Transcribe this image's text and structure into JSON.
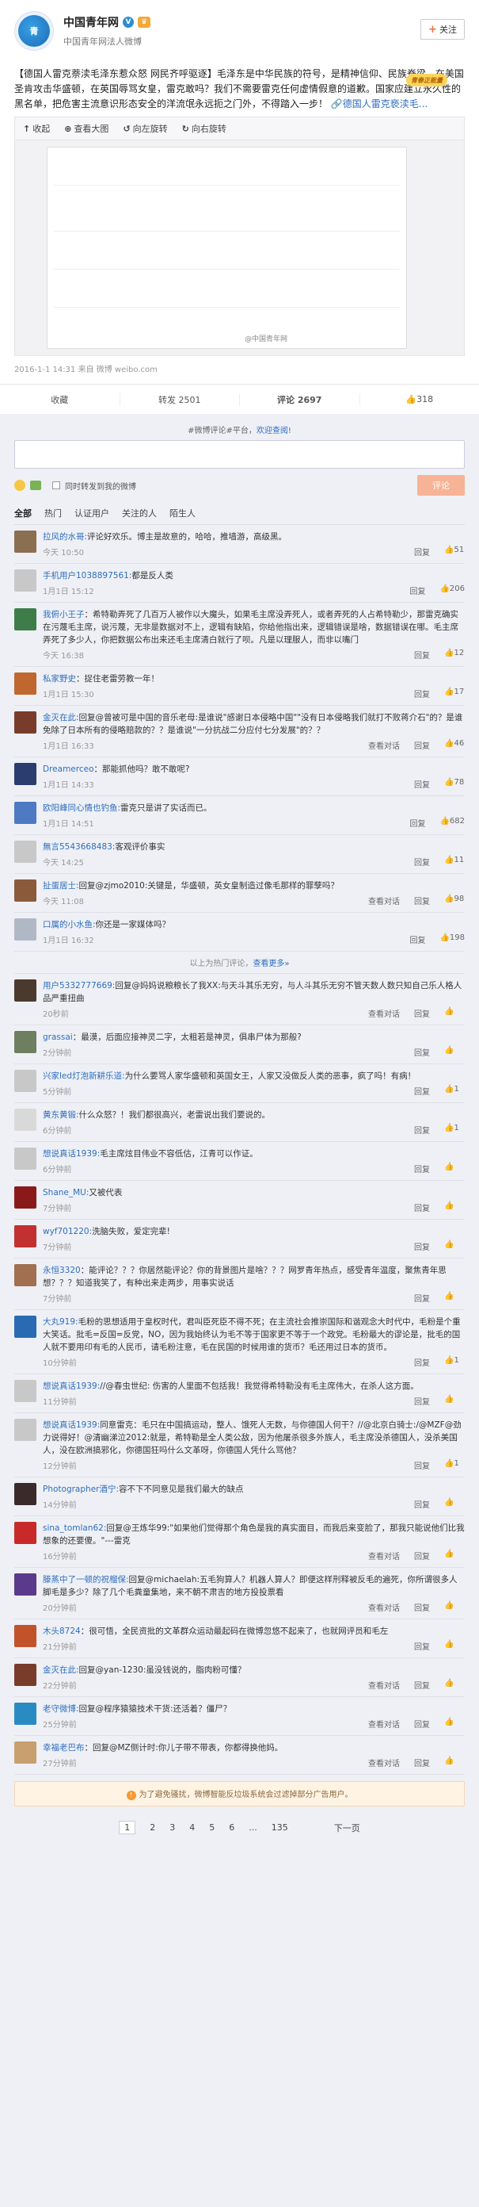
{
  "header": {
    "name": "中国青年网",
    "sub": "中国青年网法人微博",
    "follow": "关注",
    "pendant": "青春正能量"
  },
  "post": {
    "title_link": "【德国人雷克萘渎毛泽东惹众怒 网民齐呼驱逐】",
    "text": "毛泽东是中华民族的符号，是精神信仰、民族脊梁。在美国圣肯攻击华盛顿，在英国辱骂女皇，雷克敢吗？我们不需要雷克任何虚情假意的道歉。国家应建立永久性的黑名单，把危害主流意识形态安全的洋流氓永远扼之门外，不得踏入一步！",
    "link2": "德国人雷克亵渎毛...",
    "tools": [
      "收起",
      "查看大图",
      "向左旋转",
      "向右旋转"
    ],
    "watermark": "@中国青年网",
    "meta": "2016-1-1 14:31 来自 微博 weibo.com",
    "actions": {
      "collect": "收藏",
      "repost": "转发 2501",
      "comment": "评论 2697",
      "like": "318"
    }
  },
  "composer": {
    "board": "#微博评论#平台，",
    "board_link": "欢迎查阅!",
    "sync": "同时转发到我的微博",
    "submit": "评论"
  },
  "filters": [
    "全部",
    "热门",
    "认证用户",
    "关注的人",
    "陌生人"
  ],
  "comments": [
    {
      "name": "拉风的水哥:",
      "text": "评论好欢乐。博主是故意的，哈哈，推墙游，高级黑。",
      "time": "今天 10:50",
      "ops": [
        "回复"
      ],
      "likes": "51",
      "color": "#8a6f50"
    },
    {
      "name": "手机用户1038897561:",
      "text": "都是反人类",
      "time": "1月1日 15:12",
      "ops": [
        "回复"
      ],
      "likes": "206",
      "color": "#c8c8c8"
    },
    {
      "name": "我俯小王子",
      "text": "：希特勒弄死了几百万人被作以大魔头，如果毛主席没弄死人，或者弄死的人占希特勒少，那雷克确实在污蔑毛主席，说污蔑，无非是数据对不上，逻辑有缺陷，你给他指出来，逻辑错误是啥，数据错误在哪。毛主席弄死了多少人，你把数据公布出来还毛主席清白就行了呗。凡是以理服人，而非以嘴门",
      "time": "今天 16:38",
      "ops": [
        "回复"
      ],
      "likes": "12",
      "color": "#3e7d4a"
    },
    {
      "name": "私家野史",
      "text": "：捉住老雷劳教一年！",
      "time": "1月1日 15:30",
      "ops": [
        "回复"
      ],
      "likes": "17",
      "color": "#c0672f"
    },
    {
      "name": "金灭在此:",
      "text": "回复@曾被可是中国的音乐老母:是谁说\"感谢日本侵略中国\"\"没有日本侵略我们就打不败蒋介石\"的？是谁免除了日本所有的侵略赔款的？？是谁说\"一分抗战二分应付七分发展\"的？？",
      "time": "1月1日 16:33",
      "ops": [
        "查看对话",
        "回复"
      ],
      "likes": "46",
      "color": "#7a3c2a"
    },
    {
      "name": "Dreamerceo",
      "text": "：那能抓他吗？敢不敢呢?",
      "time": "1月1日 14:33",
      "ops": [
        "回复"
      ],
      "likes": "78",
      "color": "#2a3d6e"
    },
    {
      "name": "欧阳峰同心情也钓鱼:",
      "text": "雷克只是讲了实话而已。",
      "time": "1月1日 14:51",
      "ops": [
        "回复"
      ],
      "likes": "682",
      "color": "#4d7ac2"
    },
    {
      "name": "無言5543668483:",
      "text": "客观评价事实",
      "time": "今天 14:25",
      "ops": [
        "回复"
      ],
      "likes": "11",
      "color": "#c8c8c8"
    },
    {
      "name": "扯蛋居士:",
      "text": "回复@zjmo2010:关键是，华盛顿，英女皇制造过像毛那样的罪孽吗？",
      "time": "今天 11:08",
      "ops": [
        "查看对话",
        "回复"
      ],
      "likes": "98",
      "color": "#8a5a3a"
    },
    {
      "name": "口属的小水鱼:",
      "text": "你还是一家媒体吗？",
      "time": "1月1日 16:32",
      "ops": [
        "回复"
      ],
      "likes": "198",
      "color": "#b0b8c6"
    }
  ],
  "divider": {
    "text": "以上为热门评论，",
    "link": "查看更多»"
  },
  "comments2": [
    {
      "name": "用户5332777669:",
      "text": "回复@妈妈说粮粮长了我XX:与天斗其乐无穷，与人斗其乐无穷不管天数人数只知自己乐人格人品严重扭曲",
      "time": "20秒前",
      "ops": [
        "查看对话",
        "回复"
      ],
      "likes": "",
      "color": "#4a3a2e"
    },
    {
      "name": "grassai",
      "text": "：最漠，后面应接神灵二字，太粗若是神灵，俱串尸体为那般?",
      "time": "2分钟前",
      "ops": [
        "回复"
      ],
      "likes": "",
      "color": "#6e7f60"
    },
    {
      "name": "兴家led灯泡新耕乐道:",
      "text": "为什么要骂人家华盛顿和英国女王，人家又没做反人类的恶事，疯了吗！有病！",
      "time": "5分钟前",
      "ops": [
        "回复"
      ],
      "likes": "1",
      "color": "#c8c8c8"
    },
    {
      "name": "黄东黄锻:",
      "text": "什么众怒？！我们都很高兴，老雷说出我们要说的。",
      "time": "6分钟前",
      "ops": [
        "回复"
      ],
      "likes": "1",
      "color": "#d9d9d9"
    },
    {
      "name": "想说真话1939:",
      "text": "毛主席炫目伟业不容低估，江青可以作证。",
      "time": "6分钟前",
      "ops": [
        "回复"
      ],
      "likes": "",
      "color": "#c8c8c8"
    },
    {
      "name": "Shane_MU:",
      "text": "又被代表",
      "time": "7分钟前",
      "ops": [
        "回复"
      ],
      "likes": "",
      "color": "#8a1a1a"
    },
    {
      "name": "wyf701220:",
      "text": "洗脑失败，爱定完辈!",
      "time": "7分钟前",
      "ops": [
        "回复"
      ],
      "likes": "",
      "color": "#c23030"
    },
    {
      "name": "永恒3320",
      "text": "：能评论？？？你居然能评论？你的背景图片是啥？？？网罗青年热点，感受青年温度，聚焦青年思想？？？知道我笑了，有种出来走两步，用事实说话",
      "time": "7分钟前",
      "ops": [
        "回复"
      ],
      "likes": "",
      "color": "#a07050"
    },
    {
      "name": "大丸919:",
      "text": "毛粉的思想适用于皇权时代，君叫臣死臣不得不死；在主流社会推崇国际和谐观念大时代中，毛粉是个重大笑话。批毛=反国=反党，NO，因为我始终认为毛不等于国家更不等于一个政党。毛粉最大的谬论是，批毛的国人就不要用印有毛的人民币，请毛粉注意，毛在民国的时候用谁的货币？毛还用过日本的货币。",
      "time": "10分钟前",
      "ops": [
        "回复"
      ],
      "likes": "1",
      "color": "#2a6ab3"
    },
    {
      "name": "想说真话1939:",
      "text": "//@春虫世纪: 伤害的人里面不包括我！我觉得希特勒没有毛主席伟大，在杀人这方面。",
      "time": "11分钟前",
      "ops": [
        "回复"
      ],
      "likes": "",
      "color": "#c8c8c8"
    },
    {
      "name": "想说真话1939:",
      "text": "同意雷克：毛只在中国搞运动，整人、饿死人无数，与你德国人何干？//@北京白骑士:/@MZF@劲力说得好！@清幽涕泣2012:就是，希特勒是全人类公敌，因为他屠杀很多外族人，毛主席没杀德国人，没杀美国人，没在欧洲搞邪化，你德国狂吗什么文革呀，你德国人凭什么骂他？",
      "time": "12分钟前",
      "ops": [
        "回复"
      ],
      "likes": "1",
      "color": "#c8c8c8"
    },
    {
      "name": "Photographer酒宁:",
      "text": "容不下不同意见是我们最大的缺点",
      "time": "14分钟前",
      "ops": [
        "回复"
      ],
      "likes": "",
      "color": "#3a2a2a"
    },
    {
      "name": "sina_tomlan62:",
      "text": "回复@王炼华99:\"如果他们觉得那个角色是我的真实面目，而我后来变脸了，那我只能说他们比我想象的还要傻。\"---雷克",
      "time": "16分钟前",
      "ops": [
        "查看对话",
        "回复"
      ],
      "likes": "",
      "color": "#c82a2a"
    },
    {
      "name": "滕蒸中了一顿的祝榴保:",
      "text": "回复@michaelah:五毛狗算人？机器人算人？即便这样刑释被反毛的遍死，你所谓很多人脚毛是多少？除了几个毛粪童集地，来不朝不肃吉的地方投投票看",
      "time": "20分钟前",
      "ops": [
        "查看对话",
        "回复"
      ],
      "likes": "",
      "color": "#5a3a8a"
    },
    {
      "name": "木头8724",
      "text": "：很可悟，全民资批的文革群众运动最起码在微博忽悠不起来了，也就网评员和毛左",
      "time": "21分钟前",
      "ops": [
        "回复"
      ],
      "likes": "",
      "color": "#c2522a"
    },
    {
      "name": "金灭在此:",
      "text": "回复@yan-1230:虽没钱说的，脂肉粉可懂？",
      "time": "22分钟前",
      "ops": [
        "查看对话",
        "回复"
      ],
      "likes": "",
      "color": "#7a3c2a"
    },
    {
      "name": "老守微博:",
      "text": "回复@程序猿猿技术干货:还活着？僵尸？",
      "time": "25分钟前",
      "ops": [
        "查看对话",
        "回复"
      ],
      "likes": "",
      "color": "#2a8ac2"
    },
    {
      "name": "幸福老巴布",
      "text": "：回复@MZ侧计时:你儿子带不带表，你都得换他妈。",
      "time": "27分钟前",
      "ops": [
        "查看对话",
        "回复"
      ],
      "likes": "",
      "color": "#c8a070"
    }
  ],
  "notice": "为了避免骚扰，微博智能反垃圾系统会过滤掉部分广告用户。",
  "pager": {
    "pages": [
      "1",
      "2",
      "3",
      "4",
      "5",
      "6",
      "...",
      "135"
    ],
    "next": "下一页"
  }
}
